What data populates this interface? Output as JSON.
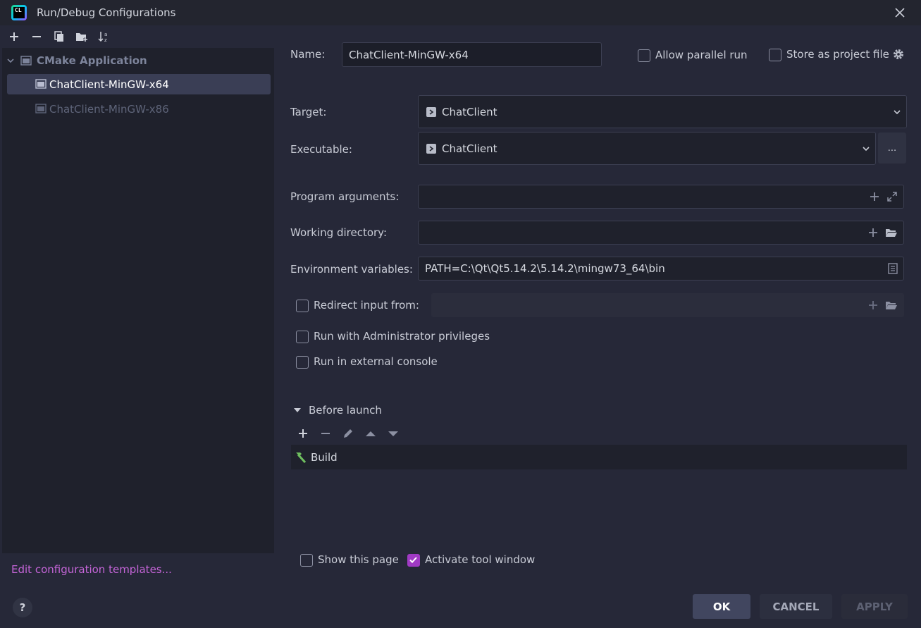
{
  "window": {
    "title": "Run/Debug Configurations",
    "logo_text": "CL"
  },
  "tree": {
    "group_label": "CMake Application",
    "items": [
      {
        "label": "ChatClient-MinGW-x64",
        "selected": true
      },
      {
        "label": "ChatClient-MinGW-x86",
        "selected": false
      }
    ],
    "edit_templates": "Edit configuration templates..."
  },
  "form": {
    "name_label": "Name:",
    "name_value": "ChatClient-MinGW-x64",
    "allow_parallel_label": "Allow parallel run",
    "store_as_file_label": "Store as project file",
    "target_label": "Target:",
    "target_value": "ChatClient",
    "executable_label": "Executable:",
    "executable_value": "ChatClient",
    "browse_label": "...",
    "program_args_label": "Program arguments:",
    "program_args_value": "",
    "working_dir_label": "Working directory:",
    "working_dir_value": "",
    "env_vars_label": "Environment variables:",
    "env_vars_value": "PATH=C:\\Qt\\Qt5.14.2\\5.14.2\\mingw73_64\\bin",
    "redirect_input_label": "Redirect input from:",
    "admin_label": "Run with Administrator privileges",
    "external_console_label": "Run in external console"
  },
  "before_launch": {
    "label": "Before launch",
    "items": [
      "Build"
    ]
  },
  "footer": {
    "show_page_label": "Show this page",
    "show_page_checked": false,
    "activate_tool_label": "Activate tool window",
    "activate_tool_checked": true,
    "ok": "OK",
    "cancel": "CANCEL",
    "apply": "APPLY",
    "help": "?"
  },
  "colors": {
    "accent": "#a03ac4",
    "link": "#c565d8",
    "background": "#262838"
  }
}
